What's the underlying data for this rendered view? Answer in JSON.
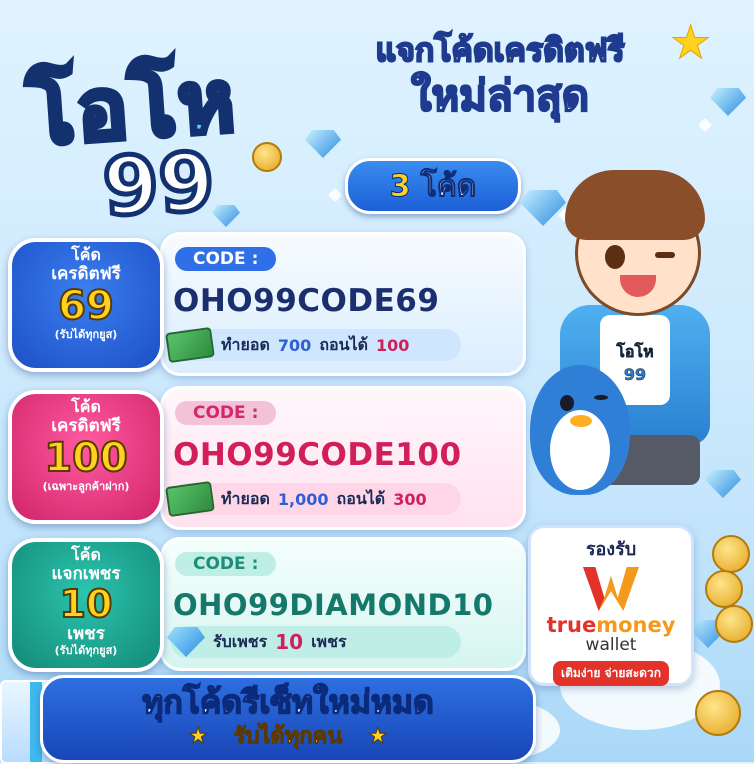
{
  "logo": {
    "main": "โอโห",
    "number": "99"
  },
  "headline": {
    "line1": "แจกโค้ดเครดิตฟรี",
    "line2": "ใหม่ล่าสุด"
  },
  "count": {
    "number": "3",
    "label": "โค้ด"
  },
  "cards": [
    {
      "badge": {
        "line1": "โค้ด",
        "line2": "เครดิตฟรี",
        "big": "69",
        "small": "(รับได้ทุกยูส)"
      },
      "code_label": "CODE :",
      "code": "OHO99CODE69",
      "reward": {
        "prefix": "ทำยอด",
        "amount": "700",
        "mid": "ถอนได้",
        "payout": "100"
      }
    },
    {
      "badge": {
        "line1": "โค้ด",
        "line2": "เครดิตฟรี",
        "big": "100",
        "small": "(เฉพาะลูกค้าฝาก)"
      },
      "code_label": "CODE :",
      "code": "OHO99CODE100",
      "reward": {
        "prefix": "ทำยอด",
        "amount": "1,000",
        "mid": "ถอนได้",
        "payout": "300"
      }
    },
    {
      "badge": {
        "line1": "โค้ด",
        "line2": "แจกเพชร",
        "big": "10",
        "unit": "เพชร",
        "small": "(รับได้ทุกยูส)"
      },
      "code_label": "CODE :",
      "code": "OHO99DIAMOND10",
      "reward": {
        "prefix": "รับเพชร",
        "amount": "10",
        "suffix": "เพชร"
      }
    }
  ],
  "character": {
    "shirt_logo_top": "โอโห",
    "shirt_logo_bottom": "99"
  },
  "wallet": {
    "supports": "รองรับ",
    "brand_true": "true",
    "brand_money": "money",
    "wallet_word": "wallet",
    "tag": "เติมง่าย จ่ายสะดวก"
  },
  "banner": {
    "line1": "ทุกโค้ดรีเซ็ทใหม่หมด",
    "line2": "รับได้ทุกคน",
    "star": "★"
  },
  "colors": {
    "accent_blue": "#2f6fe8",
    "accent_pink": "#d11f5c",
    "accent_teal": "#14786a",
    "gold": "#ffd21f"
  }
}
